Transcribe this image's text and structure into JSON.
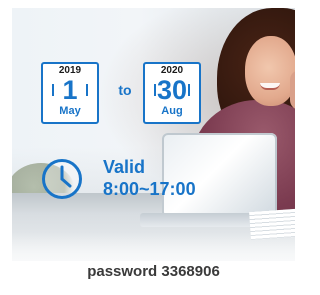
{
  "validity": {
    "from": {
      "year": "2019",
      "day": "1",
      "month": "May"
    },
    "to_label": "to",
    "to": {
      "year": "2020",
      "day": "30",
      "month": "Aug"
    },
    "valid_label": "Valid",
    "hours": "8:00~17:00"
  },
  "password": {
    "text": "password 3368906"
  },
  "icons": {
    "calendar": "calendar-icon",
    "clock": "clock-icon"
  },
  "colors": {
    "accent": "#1874c8",
    "text_dark": "#3a3a3a"
  }
}
